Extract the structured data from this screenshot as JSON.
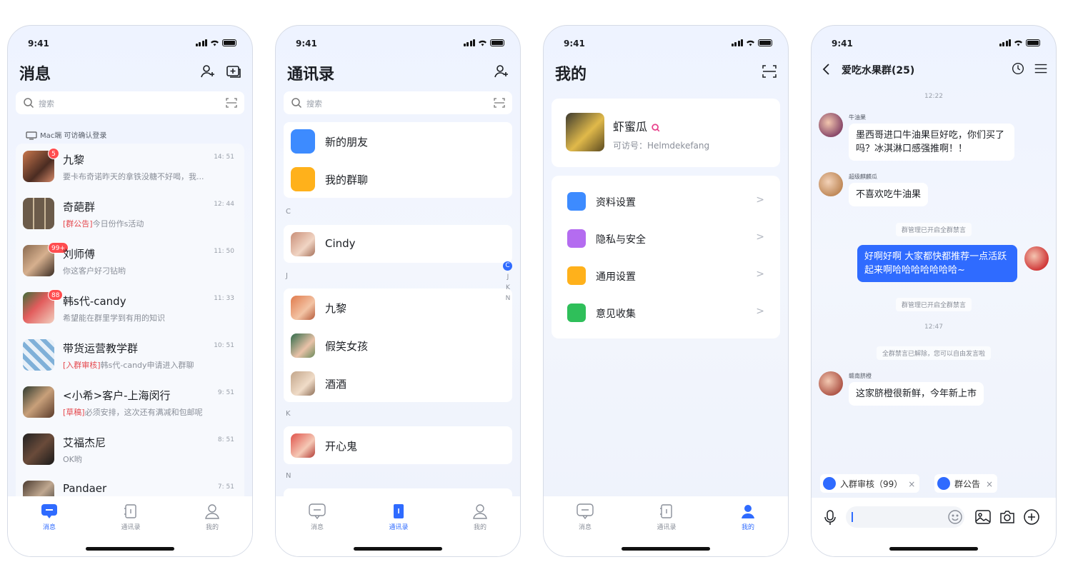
{
  "status": {
    "time": "9:41"
  },
  "tabs": {
    "messages": "消息",
    "contacts": "通讯录",
    "mine": "我的"
  },
  "search": {
    "placeholder": "搜索"
  },
  "messages_screen": {
    "title": "消息",
    "mac_notice": "Mac端 可访确认登录",
    "items": [
      {
        "name": "九黎",
        "time": "14: 51",
        "preview": "要卡布奇诺昨天的拿铁没糖不好喝，我...",
        "badge": "5",
        "tag": ""
      },
      {
        "name": "奇葩群",
        "time": "12: 44",
        "preview": "今日份作s活动",
        "badge": "",
        "tag": "[群公告]"
      },
      {
        "name": "刘师傅",
        "time": "11: 50",
        "preview": "你这客户好刁钻哟",
        "badge": "99+",
        "tag": ""
      },
      {
        "name": "韩s代-candy",
        "time": "11: 33",
        "preview": "希望能在群里学到有用的知识",
        "badge": "88",
        "tag": ""
      },
      {
        "name": "带货运营教学群",
        "time": "10: 51",
        "preview": "韩s代-candy申请进入群聊",
        "badge": "",
        "tag": "[入群审核]"
      },
      {
        "name": "<小希>客户-上海闵行",
        "time": "9: 51",
        "preview": "必须安排，这次还有满减和包邮呢",
        "badge": "",
        "tag": "[草稿]"
      },
      {
        "name": "艾福杰尼",
        "time": "8: 51",
        "preview": "OK哟",
        "badge": "",
        "tag": ""
      },
      {
        "name": "Pandaer",
        "time": "7: 51",
        "preview": "",
        "badge": "",
        "tag": ""
      }
    ]
  },
  "contacts_screen": {
    "title": "通讯录",
    "new_friends": "新的朋友",
    "my_groups": "我的群聊",
    "sections": [
      {
        "letter": "C",
        "contacts": [
          "Cindy"
        ]
      },
      {
        "letter": "J",
        "contacts": [
          "九黎",
          "假笑女孩",
          "酒酒"
        ]
      },
      {
        "letter": "K",
        "contacts": [
          "开心鬼"
        ]
      },
      {
        "letter": "N",
        "contacts": []
      }
    ],
    "index": [
      "C",
      "J",
      "K",
      "N"
    ]
  },
  "mine_screen": {
    "title": "我的",
    "nickname": "虾蜜瓜",
    "account_id": "可访号：Helmdekefang",
    "menu": [
      "资料设置",
      "隐私与安全",
      "通用设置",
      "意见收集"
    ]
  },
  "chat_screen": {
    "title": "爱吃水果群(25)",
    "time1": "12:22",
    "msg1_sender": "牛油果",
    "msg1_text": "墨西哥进口牛油果巨好吃，你们买了吗？冰淇淋口感强推啊！！",
    "msg2_sender": "超级麒麟瓜",
    "msg2_text": "不喜欢吃牛油果",
    "sys1": "群管理已开启全群禁言",
    "msg3_text": "好啊好啊 大家都快都推荐一点活跃起来啊哈哈哈哈哈哈哈~",
    "sys2": "群管理已开启全群禁言",
    "time2": "12:47",
    "sys3": "全群禁言已解除，您可以自由发言啦",
    "msg4_sender": "赣南脐橙",
    "msg4_text": "这家脐橙很新鲜，今年新上市",
    "chip1": "入群审核（99）",
    "chip2": "群公告",
    "chip_close": "×"
  },
  "colors": {
    "accent": "#2f6bff",
    "badge": "#ff4d4f",
    "tag": "#e5484d"
  }
}
